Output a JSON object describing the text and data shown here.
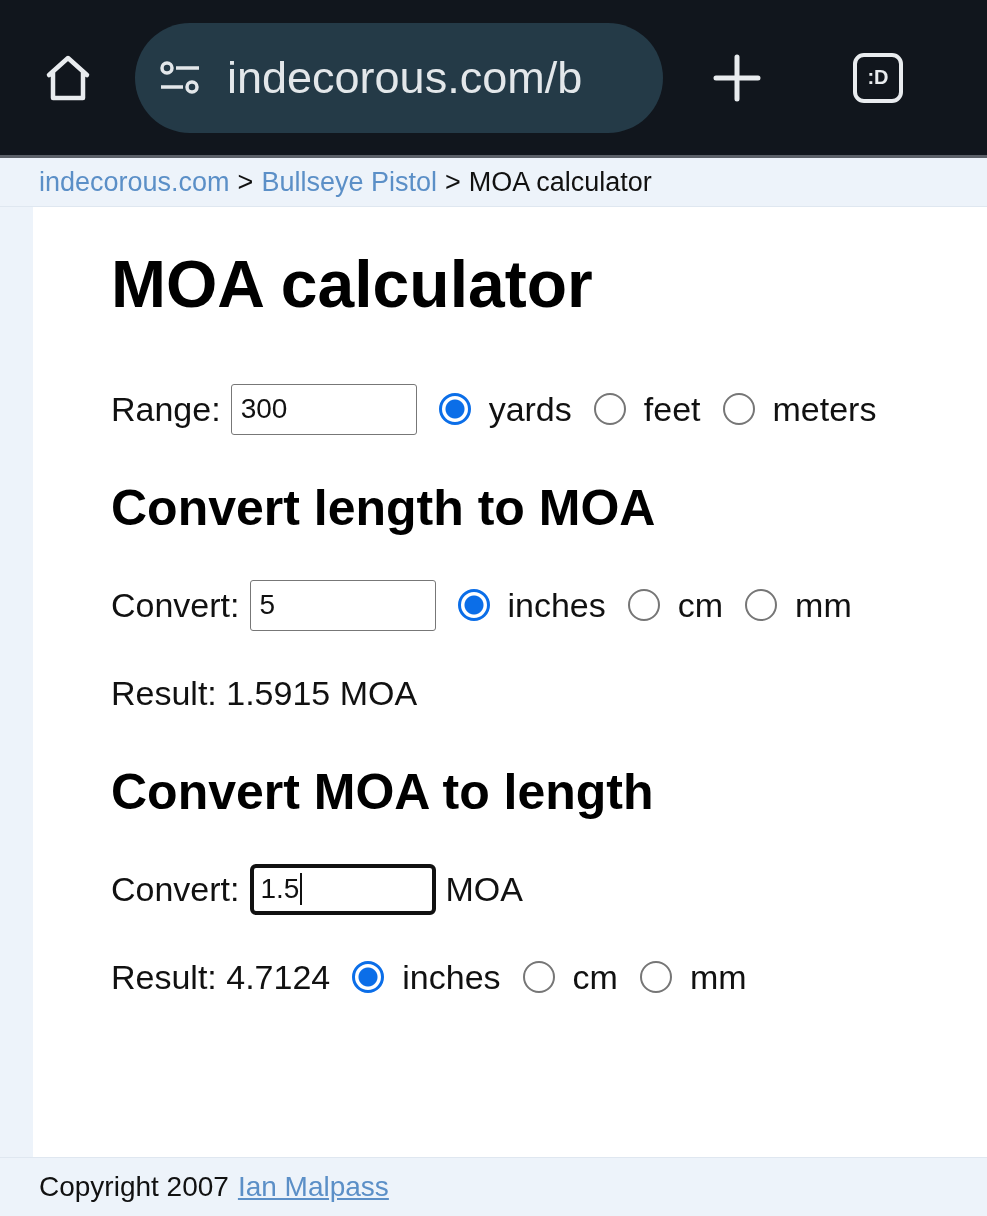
{
  "browser": {
    "url": "indecorous.com/b",
    "tab_switcher": ":D"
  },
  "breadcrumb": [
    {
      "label": "indecorous.com",
      "kind": "link"
    },
    {
      "label": ">",
      "kind": "separator"
    },
    {
      "label": "Bullseye Pistol",
      "kind": "link"
    },
    {
      "label": ">",
      "kind": "separator"
    },
    {
      "label": "MOA calculator",
      "kind": "current"
    }
  ],
  "title": "MOA calculator",
  "range": {
    "kind": "input",
    "label": "Range:",
    "value": "300",
    "focused": false,
    "options": [
      {
        "label": "yards",
        "selected": true
      },
      {
        "label": "feet",
        "selected": false
      },
      {
        "label": "meters",
        "selected": false
      }
    ]
  },
  "sections": [
    {
      "heading": "Convert length to MOA",
      "rows": [
        {
          "kind": "input",
          "label": "Convert:",
          "value": "5",
          "focused": false,
          "options": [
            {
              "label": "inches",
              "selected": true
            },
            {
              "label": "cm",
              "selected": false
            },
            {
              "label": "mm",
              "selected": false
            }
          ]
        },
        {
          "kind": "result",
          "text": "Result: 1.5915 MOA"
        }
      ]
    },
    {
      "heading": "Convert MOA to length",
      "rows": [
        {
          "kind": "input",
          "label": "Convert:",
          "value": "1.5",
          "focused": true,
          "unit": "MOA"
        },
        {
          "kind": "result",
          "text": "Result: 4.7124",
          "options": [
            {
              "label": "inches",
              "selected": true
            },
            {
              "label": "cm",
              "selected": false
            },
            {
              "label": "mm",
              "selected": false
            }
          ]
        }
      ]
    }
  ],
  "footer": {
    "text": "Copyright 2007",
    "link": "Ian Malpass"
  }
}
